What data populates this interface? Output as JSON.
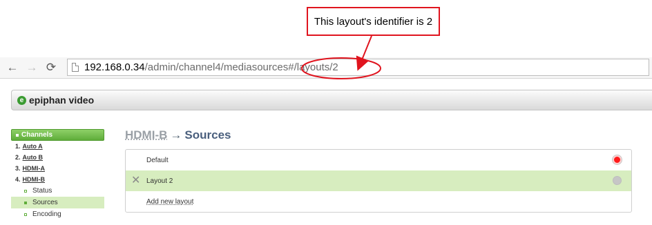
{
  "annotation": {
    "callout_text": "This layout's identifier is 2",
    "color": "#e0141e"
  },
  "browser": {
    "url_host": "192.168.0.34",
    "url_path_start": "/admin/channel4/mediasources#",
    "url_path_end": "/layouts/2",
    "back_icon": "back-arrow-icon",
    "forward_icon": "forward-arrow-icon",
    "reload_icon": "reload-icon"
  },
  "brand": {
    "name": "epiphan video",
    "logo_letter": "e",
    "color": "#3b9b32"
  },
  "sidebar": {
    "header": "Channels",
    "channels": [
      {
        "num": "1.",
        "label": "Auto A"
      },
      {
        "num": "2.",
        "label": "Auto B"
      },
      {
        "num": "3.",
        "label": "HDMI-A"
      },
      {
        "num": "4.",
        "label": "HDMI-B"
      }
    ],
    "subitems": [
      {
        "label": "Status",
        "active": false
      },
      {
        "label": "Sources",
        "active": true
      },
      {
        "label": "Encoding",
        "active": false
      }
    ]
  },
  "main": {
    "crumb": "HDMI-B",
    "arrow": "→",
    "title": "Sources",
    "layouts": [
      {
        "label": "Default",
        "status": "active-red"
      },
      {
        "label": "Layout 2",
        "status": "inactive-grey",
        "selected": true
      }
    ],
    "add_link": "Add new layout"
  }
}
